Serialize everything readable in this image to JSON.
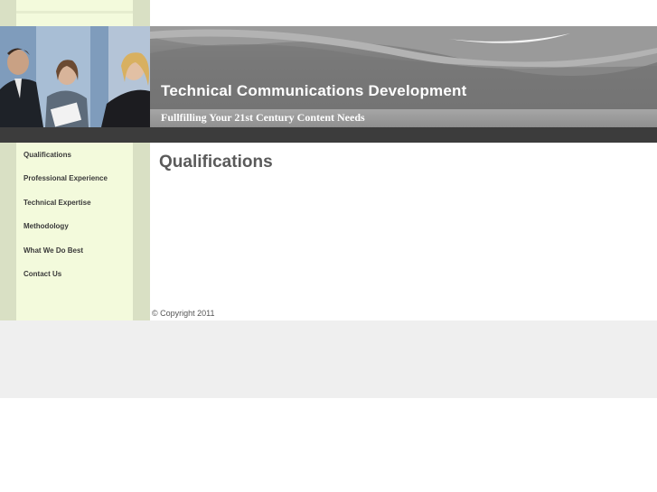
{
  "header": {
    "title": "Technical Communications Development",
    "subtitle": "Fullfilling Your 21st Century Content Needs",
    "photo": "business-people-photo"
  },
  "sidebar": {
    "items": [
      {
        "label": "Qualifications"
      },
      {
        "label": "Professional Experience"
      },
      {
        "label": "Technical Expertise"
      },
      {
        "label": "Methodology"
      },
      {
        "label": "What We Do Best"
      },
      {
        "label": "Contact Us"
      }
    ]
  },
  "main": {
    "title": "Qualifications",
    "copyright": "© Copyright 2011"
  },
  "colors": {
    "sidebar_bg": "#f3fadc",
    "sidebar_edge": "#d9e0c4",
    "banner_gray": "#7d7d7d",
    "dark_band": "#3c3c3c",
    "title_gray": "#5a5a5a",
    "footer_bg": "#efefef"
  }
}
